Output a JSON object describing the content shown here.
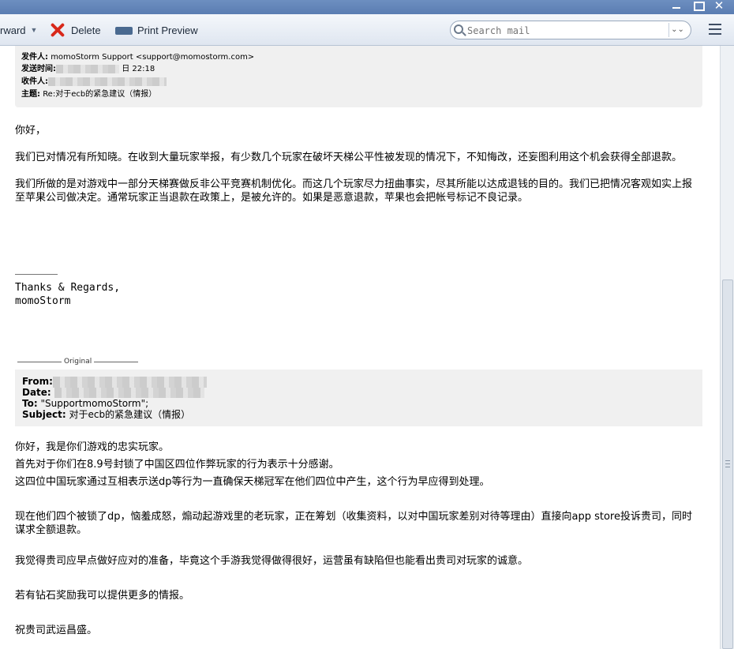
{
  "window": {
    "minimize_glyph": "",
    "maximize_glyph": "",
    "close_glyph": "✕"
  },
  "toolbar": {
    "forward_label": "rward",
    "delete_label": "Delete",
    "print_label": "Print Preview",
    "search_placeholder": "Search mail",
    "search_dropdown_glyph": "⌄⌄"
  },
  "message": {
    "from_label": "发件人:",
    "from_value": "momoStorm Support <support@momostorm.com>",
    "sent_label": "发送时间:",
    "sent_value": "日 22:18",
    "to_label": "收件人:",
    "subject_label": "主题:",
    "subject_value": "Re:对于ecb的紧急建议（情报）",
    "greeting": "你好，",
    "paragraph1": "我们已对情况有所知晓。在收到大量玩家举报，有少数几个玩家在破坏天梯公平性被发现的情况下，不知悔改，还妄图利用这个机会获得全部退款。",
    "paragraph2": "我们所做的是对游戏中一部分天梯赛做反非公平竞赛机制优化。而这几个玩家尽力扭曲事实，尽其所能以达成退钱的目的。我们已把情况客观如实上报至苹果公司做决定。通常玩家正当退款在政策上，是被允许的。如果是恶意退款，苹果也会把帐号标记不良记录。",
    "signature_line1": "Thanks & Regards,",
    "signature_line2": "momoStorm"
  },
  "original": {
    "divider_label": "Original",
    "from_label": "From:",
    "date_label": "Date:",
    "to_label": "To:",
    "to_value": "\"SupportmomoStorm\";",
    "subject_label": "Subject:",
    "subject_value": "对于ecb的紧急建议（情报）",
    "line1": "你好，我是你们游戏的忠实玩家。",
    "line2": "首先对于你们在8.9号封锁了中国区四位作弊玩家的行为表示十分感谢。",
    "line3": "这四位中国玩家通过互相表示送dp等行为一直确保天梯冠军在他们四位中产生，这个行为早应得到处理。",
    "line4": "现在他们四个被锁了dp，恼羞成怒，煽动起游戏里的老玩家，正在筹划（收集资料，以对中国玩家差别对待等理由）直接向app store投诉贵司，同时谋求全额退款。",
    "line5": "我觉得贵司应早点做好应对的准备，毕竟这个手游我觉得做得很好，运营虽有缺陷但也能看出贵司对玩家的诚意。",
    "line6": "若有钻石奖励我可以提供更多的情报。",
    "line7": "祝贵司武运昌盛。"
  }
}
